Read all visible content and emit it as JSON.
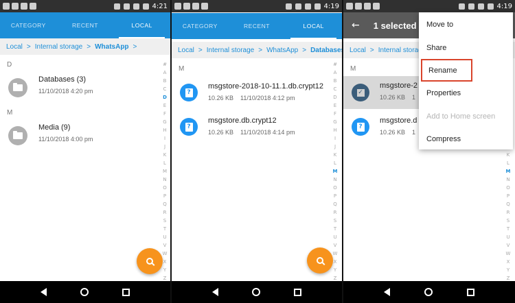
{
  "status": {
    "times": [
      "4:21",
      "4:19",
      "4:19"
    ]
  },
  "tabs": {
    "category": "CATEGORY",
    "recent": "RECENT",
    "local": "LOCAL"
  },
  "panel1": {
    "breadcrumb": {
      "local": "Local",
      "internal": "Internal storage",
      "current": "WhatsApp",
      "sep": ">"
    },
    "sections": {
      "d": "D",
      "m": "M"
    },
    "items": [
      {
        "name": "Databases (3)",
        "meta": "11/10/2018 4:20 pm",
        "icon": "folder-icon"
      },
      {
        "name": "Media (9)",
        "meta": "11/10/2018 4:00 pm",
        "icon": "folder-icon"
      }
    ],
    "alpha_active": "D"
  },
  "panel2": {
    "breadcrumb": {
      "local": "Local",
      "internal": "Internal storage",
      "whatsapp": "WhatsApp",
      "current": "Databases",
      "sep": ">"
    },
    "section": "M",
    "items": [
      {
        "name": "msgstore-2018-10-11.1.db.crypt12",
        "size": "10.26 KB",
        "date": "11/10/2018 4:12 pm",
        "icon": "document-icon"
      },
      {
        "name": "msgstore.db.crypt12",
        "size": "10.26 KB",
        "date": "11/10/2018 4:14 pm",
        "icon": "document-icon"
      }
    ],
    "alpha_active": "M"
  },
  "panel3": {
    "title": "1 selected",
    "breadcrumb": {
      "local": "Local",
      "internal": "Internal storag",
      "sep": ">"
    },
    "section": "M",
    "items": [
      {
        "name": "msgstore-2",
        "size": "10.26 KB",
        "date": "1"
      },
      {
        "name": "msgstore.d",
        "size": "10.26 KB",
        "date": "1"
      }
    ],
    "menu": [
      "Move to",
      "Share",
      "Rename",
      "Properties",
      "Add to Home screen",
      "Compress"
    ],
    "menu_highlight": "Rename",
    "menu_disabled": "Add to Home screen",
    "alpha_active": "M"
  },
  "alphabet": [
    "#",
    "A",
    "B",
    "C",
    "D",
    "E",
    "F",
    "G",
    "H",
    "I",
    "J",
    "K",
    "L",
    "M",
    "N",
    "O",
    "P",
    "Q",
    "R",
    "S",
    "T",
    "U",
    "V",
    "W",
    "X",
    "Y",
    "Z"
  ],
  "colors": {
    "accent": "#1e8fd8",
    "fab": "#f7931d",
    "highlight": "#d9442b"
  }
}
